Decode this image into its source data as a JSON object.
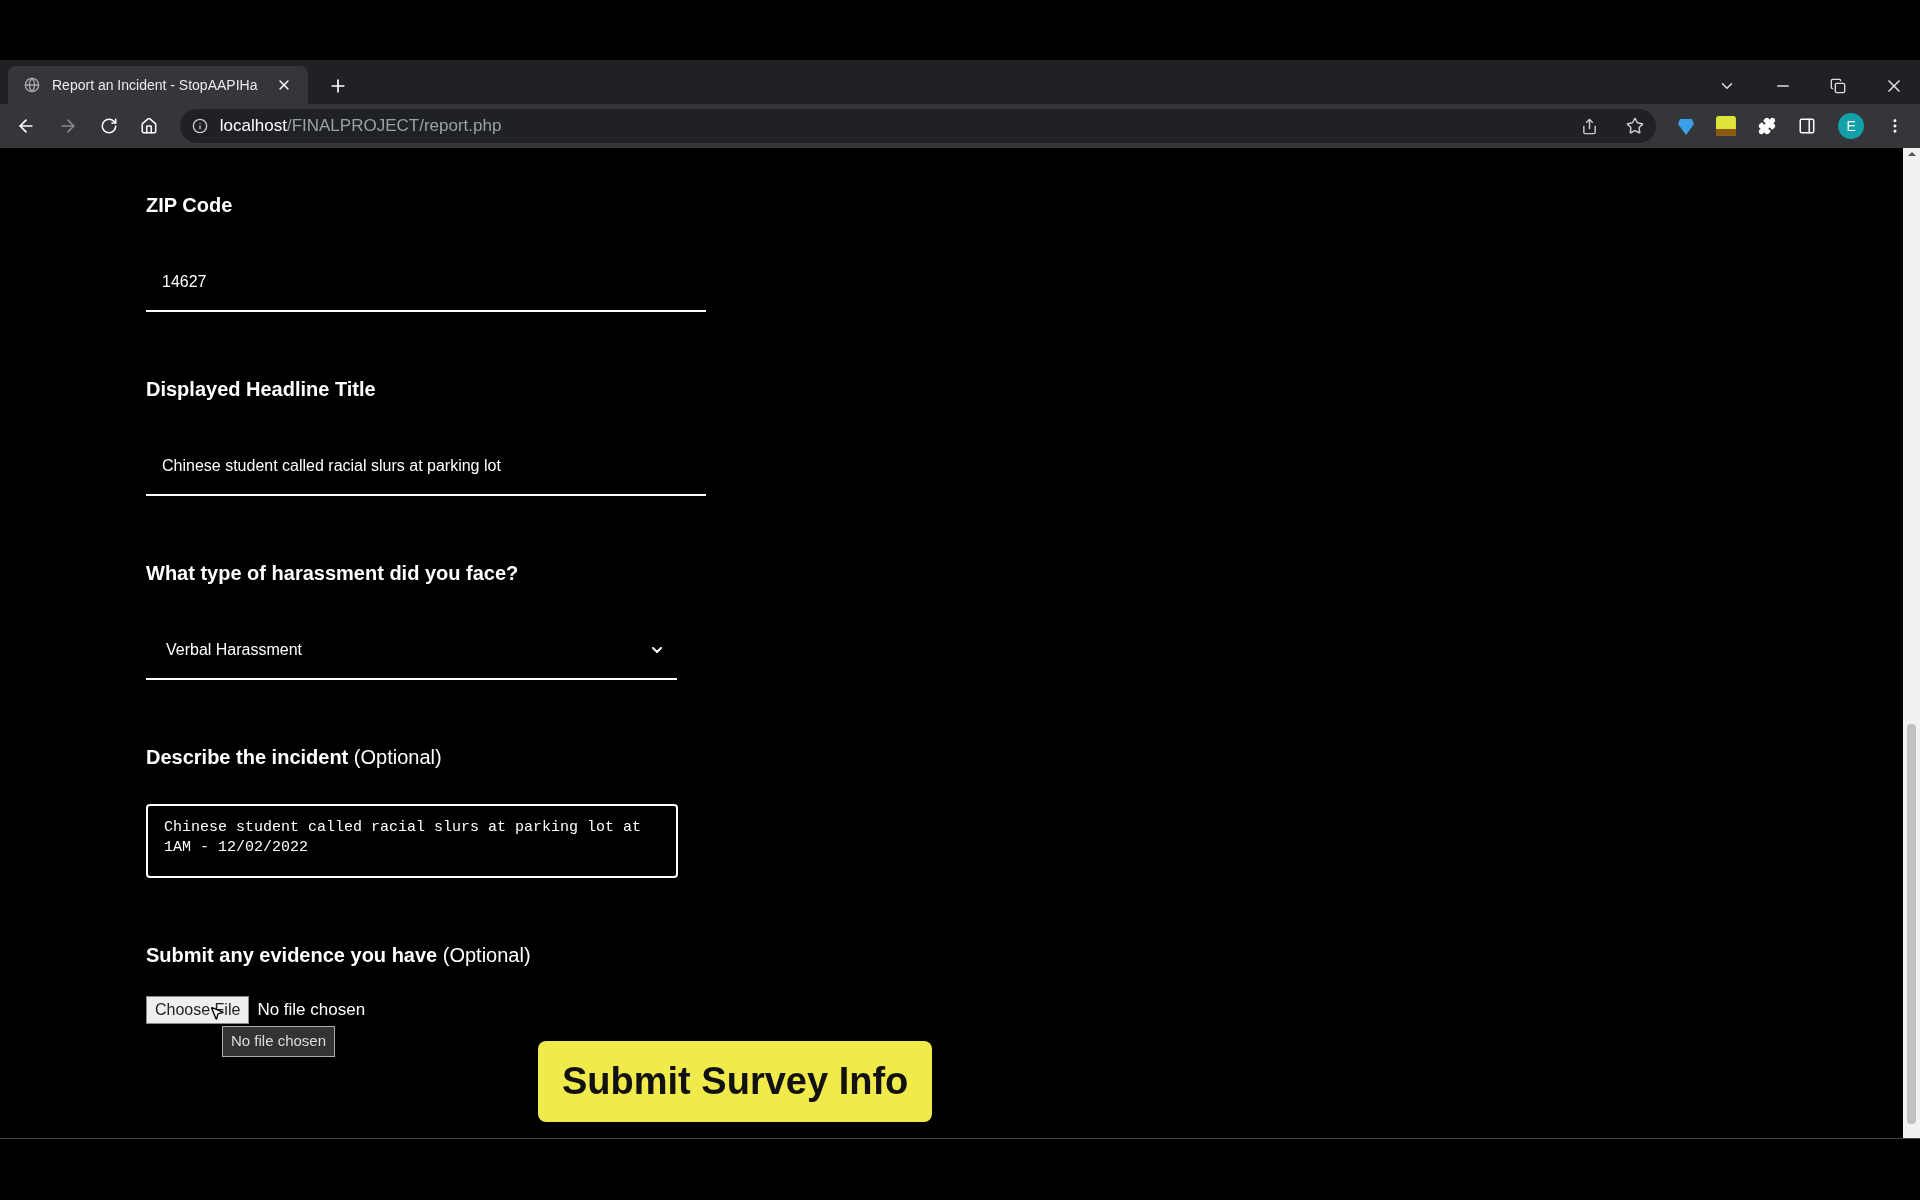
{
  "browser": {
    "tab": {
      "title": "Report an Incident - StopAAPIHa",
      "selected": true
    },
    "address": {
      "host": "localhost",
      "path": "/FINALPROJECT/report.php"
    },
    "profile_initial": "E"
  },
  "form": {
    "fields": [
      {
        "kind": "text",
        "label": "ZIP Code",
        "value": "14627"
      },
      {
        "kind": "text",
        "label": "Displayed Headline Title",
        "value": "Chinese student called racial slurs at parking lot"
      },
      {
        "kind": "select",
        "label": "What type of harassment did you face?",
        "value": "Verbal Harassment"
      },
      {
        "kind": "textarea",
        "label": "**Describe the incident** (Optional)",
        "value": "Chinese student called racial slurs at parking lot at 1AM - 12/02/2022"
      },
      {
        "kind": "file",
        "label": "**Submit any evidence you have** (Optional)",
        "button": "Choose File",
        "status": "No file chosen",
        "tooltip": "No file chosen"
      }
    ],
    "submit": "Submit Survey Info"
  }
}
